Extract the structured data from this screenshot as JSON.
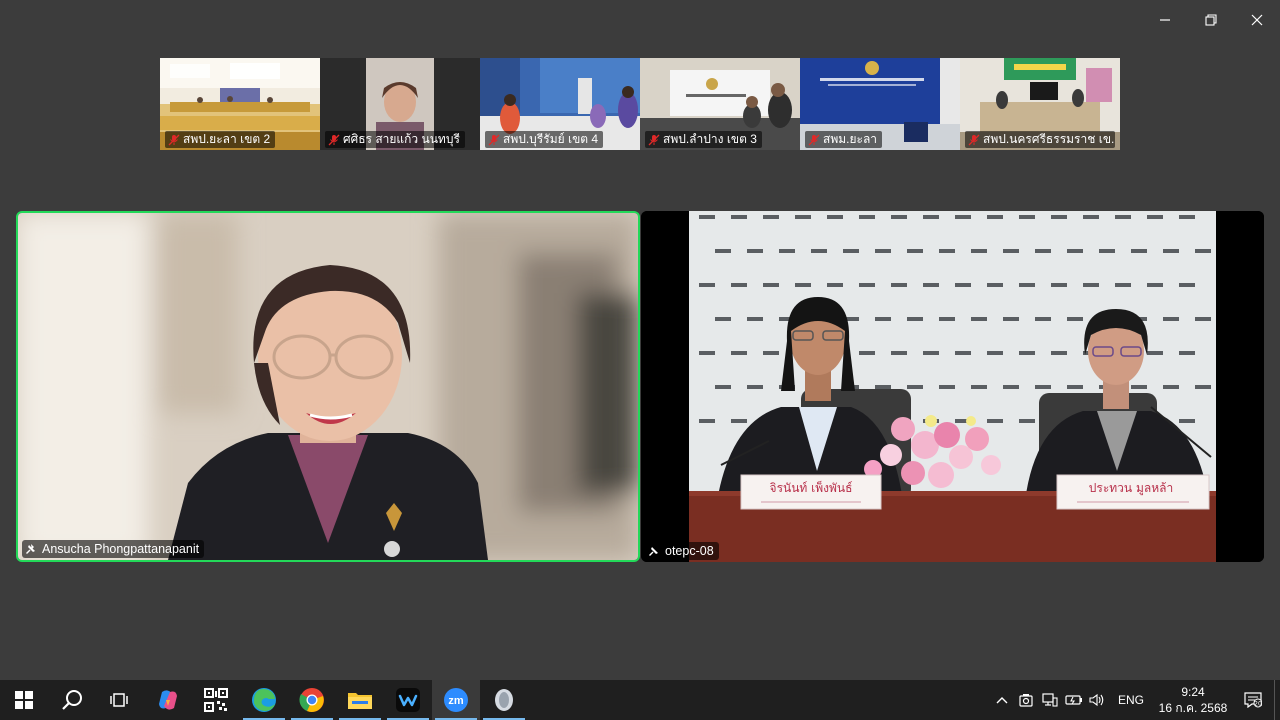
{
  "window": {
    "minimize_icon": "minimize-icon",
    "restore_icon": "restore-icon",
    "close_icon": "close-icon"
  },
  "gallery": [
    {
      "name": "สพป.ยะลา เขต 2",
      "muted": true
    },
    {
      "name": "ศศิธร สายแก้ว นนทบุรี",
      "muted": true
    },
    {
      "name": "สพป.บุรีรัมย์ เขต 4",
      "muted": true
    },
    {
      "name": "สพป.ลำปาง เขต 3",
      "muted": true
    },
    {
      "name": "สพม.ยะลา",
      "muted": true
    },
    {
      "name": "สพป.นครศรีธรรมราช เข...",
      "muted": true
    }
  ],
  "main": {
    "left": {
      "name": "Ansucha Phongpattanapanit",
      "active_speaker": true
    },
    "right": {
      "name": "otepc-08",
      "nameplate_left": "จิรนันท์ เพ็งพันธ์",
      "nameplate_right": "ประทวน มูลหล้า"
    }
  },
  "taskbar": {
    "apps": [
      "windows-start",
      "search",
      "task-view",
      "copilot",
      "qr-app",
      "edge",
      "chrome",
      "file-explorer",
      "wps-app",
      "zoom",
      "misc-app"
    ],
    "language": "ENG",
    "time": "9:24",
    "date": "16 ก.ค. 2568"
  },
  "colors": {
    "background": "#3c3c3c",
    "active_speaker_border": "#23d959",
    "taskbar": "#1f1f1f",
    "zoom_blue": "#2d8cff"
  }
}
